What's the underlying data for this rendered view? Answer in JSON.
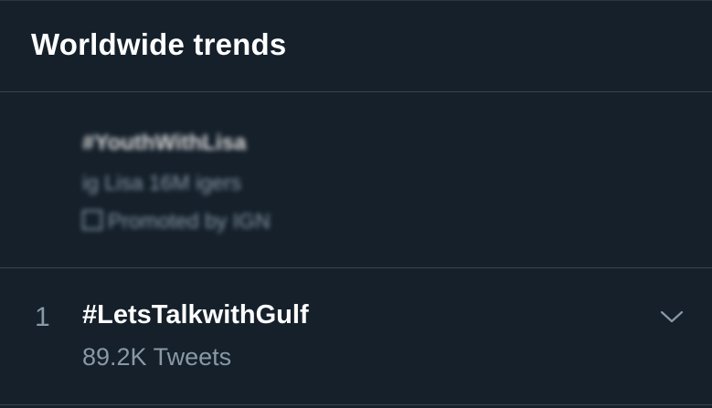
{
  "header": {
    "title": "Worldwide trends"
  },
  "promoted_trend": {
    "name": "#YouthWithLisa",
    "description": "ig Lisa 16M igers",
    "promoted_by": "Promoted by IGN"
  },
  "trends": [
    {
      "rank": "1",
      "name": "#LetsTalkwithGulf",
      "tweet_count": "89.2K Tweets",
      "menu_icon": "chevron-down-icon"
    }
  ],
  "colors": {
    "background": "#15202b",
    "divider": "#38444d",
    "primary_text": "#ffffff",
    "secondary_text": "#8899a6"
  }
}
